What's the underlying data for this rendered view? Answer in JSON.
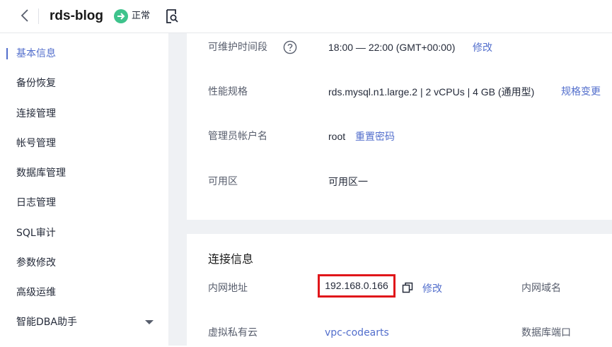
{
  "header": {
    "title": "rds-blog",
    "status": "正常",
    "icons": {
      "back": "chevron-left-icon",
      "status": "arrow-right-circle-icon",
      "doc": "document-search-icon"
    },
    "colors": {
      "status_green": "#3ec38c",
      "accent": "#526ecc"
    }
  },
  "sidebar": {
    "items": [
      {
        "label": "基本信息",
        "active": true
      },
      {
        "label": "备份恢复"
      },
      {
        "label": "连接管理"
      },
      {
        "label": "帐号管理"
      },
      {
        "label": "数据库管理"
      },
      {
        "label": "日志管理"
      },
      {
        "label": "SQL审计"
      },
      {
        "label": "参数修改"
      },
      {
        "label": "高级运维"
      },
      {
        "label": "智能DBA助手",
        "expandable": true
      }
    ]
  },
  "basic_info": {
    "maintenance": {
      "label": "可维护时间段",
      "value": "18:00 — 22:00 (GMT+00:00)",
      "action": "修改"
    },
    "spec": {
      "label": "性能规格",
      "value": "rds.mysql.n1.large.2 | 2 vCPUs | 4 GB (通用型)",
      "action": "规格变更"
    },
    "admin": {
      "label": "管理员帐户名",
      "value": "root",
      "action": "重置密码"
    },
    "az": {
      "label": "可用区",
      "value": "可用区一"
    }
  },
  "connection": {
    "title": "连接信息",
    "private_ip": {
      "label": "内网地址",
      "value": "192.168.0.166",
      "action": "修改"
    },
    "private_domain": {
      "label": "内网域名"
    },
    "vpc": {
      "label": "虚拟私有云",
      "value": "vpc-codearts"
    },
    "db_port": {
      "label": "数据库端口"
    },
    "highlight_color": "#e0161a"
  }
}
